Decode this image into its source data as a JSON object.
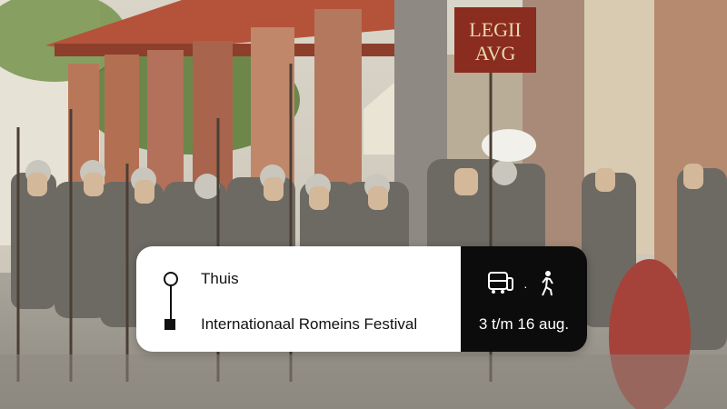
{
  "journey": {
    "from": "Thuis",
    "to": "Internationaal Romeins Festival",
    "dates": "3 t/m 16 aug.",
    "separator": "·",
    "modes": [
      "bus-train-icon",
      "walking-icon"
    ]
  },
  "scene": {
    "banner_text_line1": "LEGII",
    "banner_text_line2": "AVG",
    "colors": {
      "card": "#ffffff",
      "card_dark": "#0c0c0c",
      "banner": "#8a2c1f"
    }
  }
}
